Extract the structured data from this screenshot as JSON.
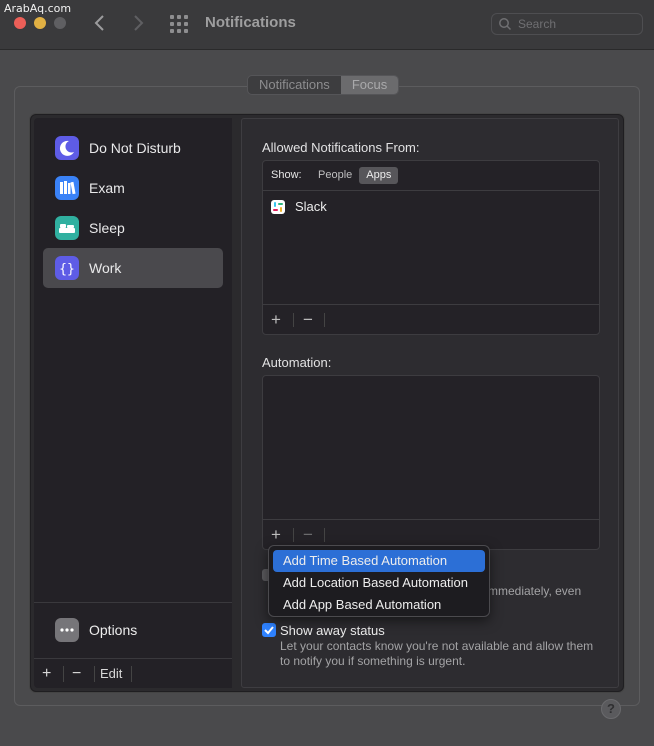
{
  "watermark": "ArabAq.com",
  "window": {
    "title": "Notifications",
    "search_placeholder": "Search"
  },
  "tabs": [
    {
      "label": "Notifications",
      "active": false
    },
    {
      "label": "Focus",
      "active": true
    }
  ],
  "sidebar": {
    "items": [
      {
        "label": "Do Not Disturb",
        "icon": "moon-icon",
        "color": "#5e5ce6",
        "selected": false
      },
      {
        "label": "Exam",
        "icon": "books-icon",
        "color": "#3a82f7",
        "selected": false
      },
      {
        "label": "Sleep",
        "icon": "bed-icon",
        "color": "#30b0a0",
        "selected": false
      },
      {
        "label": "Work",
        "icon": "braces-icon",
        "color": "#5e5ce6",
        "selected": true
      }
    ],
    "options_label": "Options",
    "footer": {
      "add": "+",
      "remove": "−",
      "edit": "Edit"
    }
  },
  "allowed": {
    "title": "Allowed Notifications From:",
    "show_label": "Show:",
    "filter_options": [
      "People",
      "Apps"
    ],
    "filter_selected": "Apps",
    "apps": [
      {
        "name": "Slack",
        "icon": "slack-icon"
      }
    ],
    "add": "+",
    "remove": "−"
  },
  "automation": {
    "title": "Automation:",
    "add": "+",
    "remove": "−",
    "menu": [
      {
        "label": "Add Time Based Automation",
        "highlighted": true
      },
      {
        "label": "Add Location Based Automation",
        "highlighted": false
      },
      {
        "label": "Add App Based Automation",
        "highlighted": false
      }
    ]
  },
  "partial_text": "mmediately, even",
  "away_status": {
    "label": "Show away status",
    "checked": true,
    "description": "Let your contacts know you're not available and allow them to notify you if something is urgent."
  },
  "help_label": "?",
  "colors": {
    "accent": "#2c6fd6",
    "checkbox": "#2e82ff"
  }
}
